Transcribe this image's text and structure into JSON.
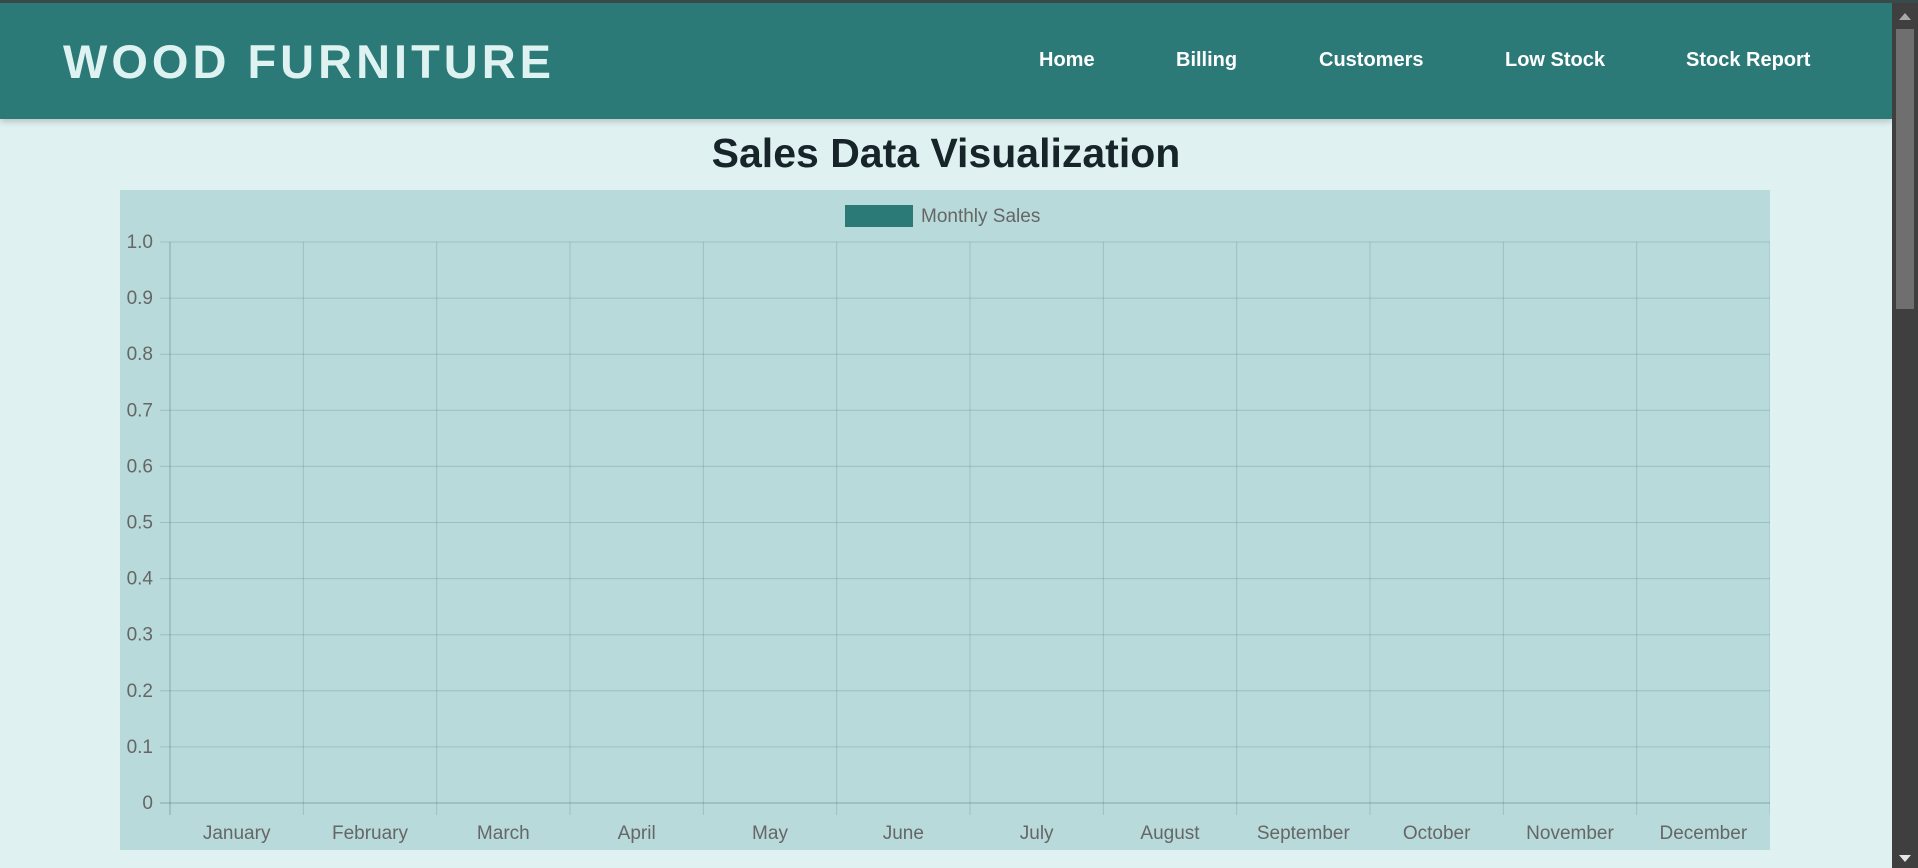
{
  "header": {
    "brand": "WOOD FURNITURE",
    "nav": [
      "Home",
      "Billing",
      "Customers",
      "Low Stock",
      "Stock Report"
    ]
  },
  "page": {
    "title": "Sales Data Visualization"
  },
  "colors": {
    "header_bg": "#2b7a78",
    "page_bg": "#dff2f1",
    "chart_bg": "#b8dada",
    "series": "#2b7a78"
  },
  "chart_data": {
    "type": "bar",
    "categories": [
      "January",
      "February",
      "March",
      "April",
      "May",
      "June",
      "July",
      "August",
      "September",
      "October",
      "November",
      "December"
    ],
    "series": [
      {
        "name": "Monthly Sales",
        "values": [
          0,
          0,
          0,
          0,
          0,
          0,
          0,
          0,
          0,
          0,
          0,
          0
        ]
      }
    ],
    "yticks": [
      "0",
      "0.1",
      "0.2",
      "0.3",
      "0.4",
      "0.5",
      "0.6",
      "0.7",
      "0.8",
      "0.9",
      "1.0"
    ],
    "ylim": [
      0,
      1
    ],
    "grid": true,
    "legend": "top-center"
  }
}
